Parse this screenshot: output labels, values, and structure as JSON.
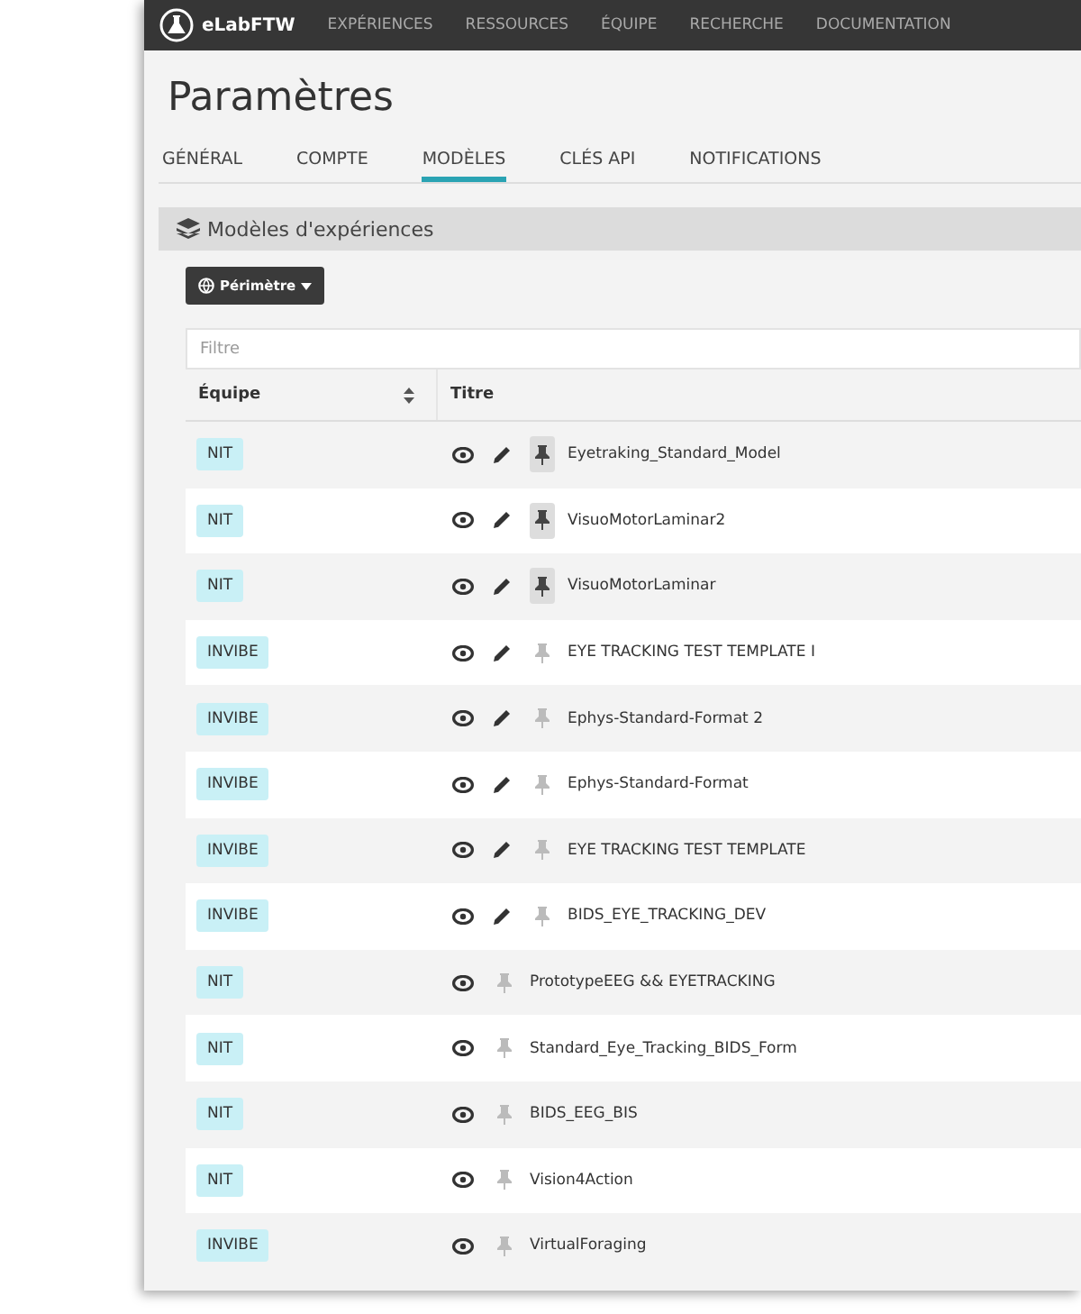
{
  "navbar": {
    "brand": "eLabFTW",
    "links": [
      "EXPÉRIENCES",
      "RESSOURCES",
      "ÉQUIPE",
      "RECHERCHE",
      "DOCUMENTATION"
    ]
  },
  "page_title": "Paramètres",
  "tabs": [
    {
      "label": "GÉNÉRAL",
      "selected": false
    },
    {
      "label": "COMPTE",
      "selected": false
    },
    {
      "label": "MODÈLES",
      "selected": true
    },
    {
      "label": "CLÉS API",
      "selected": false
    },
    {
      "label": "NOTIFICATIONS",
      "selected": false
    }
  ],
  "section": {
    "title": "Modèles d'expériences",
    "scope_button": "Périmètre",
    "filter": {
      "placeholder": "Filtre"
    }
  },
  "table": {
    "columns": [
      "Équipe",
      "Titre"
    ],
    "rows": [
      {
        "team": "NIT",
        "title": "Eyetraking_Standard_Model",
        "editable": true,
        "pinned": true
      },
      {
        "team": "NIT",
        "title": "VisuoMotorLaminar2",
        "editable": true,
        "pinned": true
      },
      {
        "team": "NIT",
        "title": "VisuoMotorLaminar",
        "editable": true,
        "pinned": true
      },
      {
        "team": "INVIBE",
        "title": "EYE TRACKING TEST TEMPLATE I",
        "editable": true,
        "pinned": false
      },
      {
        "team": "INVIBE",
        "title": "Ephys-Standard-Format 2",
        "editable": true,
        "pinned": false
      },
      {
        "team": "INVIBE",
        "title": "Ephys-Standard-Format",
        "editable": true,
        "pinned": false
      },
      {
        "team": "INVIBE",
        "title": "EYE TRACKING TEST TEMPLATE",
        "editable": true,
        "pinned": false
      },
      {
        "team": "INVIBE",
        "title": "BIDS_EYE_TRACKING_DEV",
        "editable": true,
        "pinned": false
      },
      {
        "team": "NIT",
        "title": "PrototypeEEG && EYETRACKING",
        "editable": false,
        "pinned": false
      },
      {
        "team": "NIT",
        "title": "Standard_Eye_Tracking_BIDS_Form",
        "editable": false,
        "pinned": false
      },
      {
        "team": "NIT",
        "title": "BIDS_EEG_BIS",
        "editable": false,
        "pinned": false
      },
      {
        "team": "NIT",
        "title": "Vision4Action",
        "editable": false,
        "pinned": false
      },
      {
        "team": "INVIBE",
        "title": "VirtualForaging",
        "editable": false,
        "pinned": false
      }
    ]
  }
}
